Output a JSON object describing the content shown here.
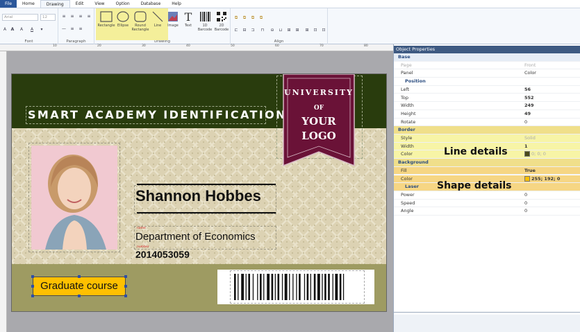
{
  "menu": [
    "File",
    "Home",
    "Drawing",
    "Edit",
    "View",
    "Option",
    "Database",
    "Help"
  ],
  "ribbon": {
    "font": {
      "family_placeholder": "Arial",
      "size_placeholder": "12",
      "caption": "Font"
    },
    "paragraph": {
      "caption": "Paragraph"
    },
    "drawing": {
      "caption": "Drawing",
      "tools": [
        "Rectangle",
        "Ellipse",
        "Round Rectangle",
        "Line",
        "Image",
        "Text",
        "1D Barcode",
        "2D Barcode"
      ]
    },
    "align": {
      "caption": "Align"
    }
  },
  "card": {
    "title": "SMART ACADEMY IDENTIFICATION",
    "logo": {
      "line1": "UNIVERSITY",
      "line2": "OF",
      "line3": "YOUR",
      "line4": "LOGO"
    },
    "name": "Shannon Hobbes",
    "department": "Department of Economics",
    "id_number": "2014053059",
    "course": "Graduate course",
    "label_dept": "name",
    "label_number": "number"
  },
  "props": {
    "title": "Object Properties",
    "sections": [
      {
        "label": "Base"
      },
      {
        "k": "Page",
        "v": "Front"
      },
      {
        "k": "Panel",
        "v": "Color"
      },
      {
        "label": "Position"
      },
      {
        "k": "Left",
        "v": "56"
      },
      {
        "k": "Top",
        "v": "552"
      },
      {
        "k": "Width",
        "v": "249"
      },
      {
        "k": "Height",
        "v": "49"
      },
      {
        "k": "Rotate",
        "v": "0"
      },
      {
        "label": "Border"
      },
      {
        "k": "Style",
        "v": "Solid"
      },
      {
        "k": "Width",
        "v": "1"
      },
      {
        "k": "Color",
        "v": "0; 0; 0"
      },
      {
        "label": "Background"
      },
      {
        "k": "Fill",
        "v": "True"
      },
      {
        "k": "Color",
        "v": "255; 192; 0"
      },
      {
        "label": "Laser"
      },
      {
        "k": "Power",
        "v": "0"
      },
      {
        "k": "Speed",
        "v": "0"
      },
      {
        "k": "Angle",
        "v": "0"
      }
    ],
    "annotation_line": "Line details",
    "annotation_shape": "Shape details"
  },
  "colors": {
    "accent": "#2b579a",
    "card_dark": "#293c0d",
    "card_light": "#dcd2b3",
    "course_fill": "#ffc000",
    "logo_fill": "#6a1237"
  }
}
